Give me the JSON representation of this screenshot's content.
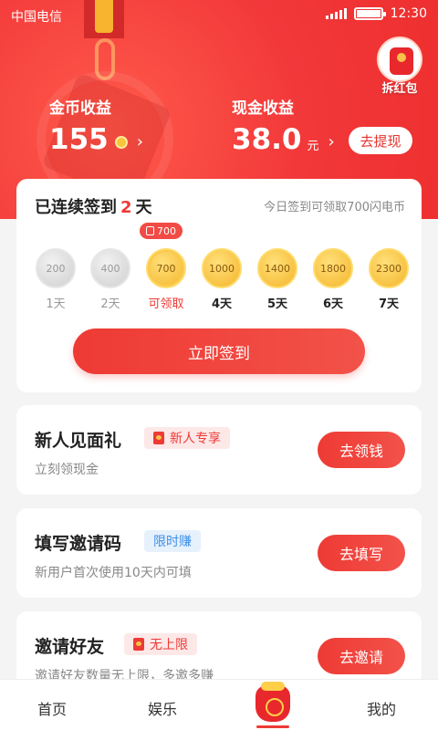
{
  "status_bar": {
    "carrier": "中国电信",
    "time": "12:30"
  },
  "header": {
    "red_packet_label": "拆红包",
    "coin_earnings": {
      "label": "金币收益",
      "value": "155"
    },
    "cash_earnings": {
      "label": "现金收益",
      "value": "38.0",
      "unit": "元"
    },
    "withdraw_label": "去提现"
  },
  "sign_in": {
    "title_prefix": "已连续签到",
    "streak_days": "2",
    "title_suffix": "天",
    "hint": "今日签到可领取700闪电币",
    "today_badge": "700",
    "days": [
      {
        "value": "200",
        "label": "1天",
        "state": "claimed"
      },
      {
        "value": "400",
        "label": "2天",
        "state": "claimed"
      },
      {
        "value": "700",
        "label": "可领取",
        "state": "today"
      },
      {
        "value": "1000",
        "label": "4天",
        "state": "future"
      },
      {
        "value": "1400",
        "label": "5天",
        "state": "future"
      },
      {
        "value": "1800",
        "label": "6天",
        "state": "future"
      },
      {
        "value": "2300",
        "label": "7天",
        "state": "future"
      }
    ],
    "button_label": "立即签到"
  },
  "tasks": [
    {
      "title": "新人见面礼",
      "tag": "新人专享",
      "tag_style": "red",
      "desc": "立刻领现金",
      "button": "去领钱"
    },
    {
      "title": "填写邀请码",
      "tag": "限时赚",
      "tag_style": "blue",
      "desc": "新用户首次使用10天内可填",
      "button": "去填写"
    },
    {
      "title": "邀请好友",
      "tag": "无上限",
      "tag_style": "red",
      "desc": "邀请好友数量无上限，多邀多赚",
      "button": "去邀请"
    }
  ],
  "bottom_nav": {
    "home": "首页",
    "entertainment": "娱乐",
    "mine": "我的"
  },
  "colors": {
    "primary_red": "#ee3a35",
    "gold": "#f4b52a",
    "tag_blue": "#3d8ee8"
  }
}
